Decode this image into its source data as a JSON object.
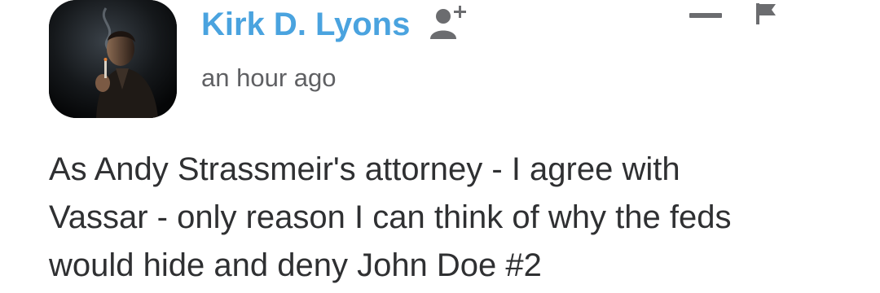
{
  "comment": {
    "author": {
      "name": "Kirk D. Lyons",
      "avatar_icon": "user-avatar-photo",
      "follow_icon": "add-user-icon"
    },
    "timestamp": "an hour ago",
    "actions": {
      "collapse_icon": "minus-icon",
      "flag_icon": "flag-icon"
    },
    "body_lines": [
      "As Andy Strassmeir's attorney - I agree with",
      "Vassar - only reason I can think of why the feds",
      "would hide and deny John Doe #2"
    ]
  },
  "colors": {
    "author_name": "#4aa3df",
    "timestamp": "#5f6063",
    "body_text": "#2f3032",
    "icons": "#6b6c6f"
  }
}
